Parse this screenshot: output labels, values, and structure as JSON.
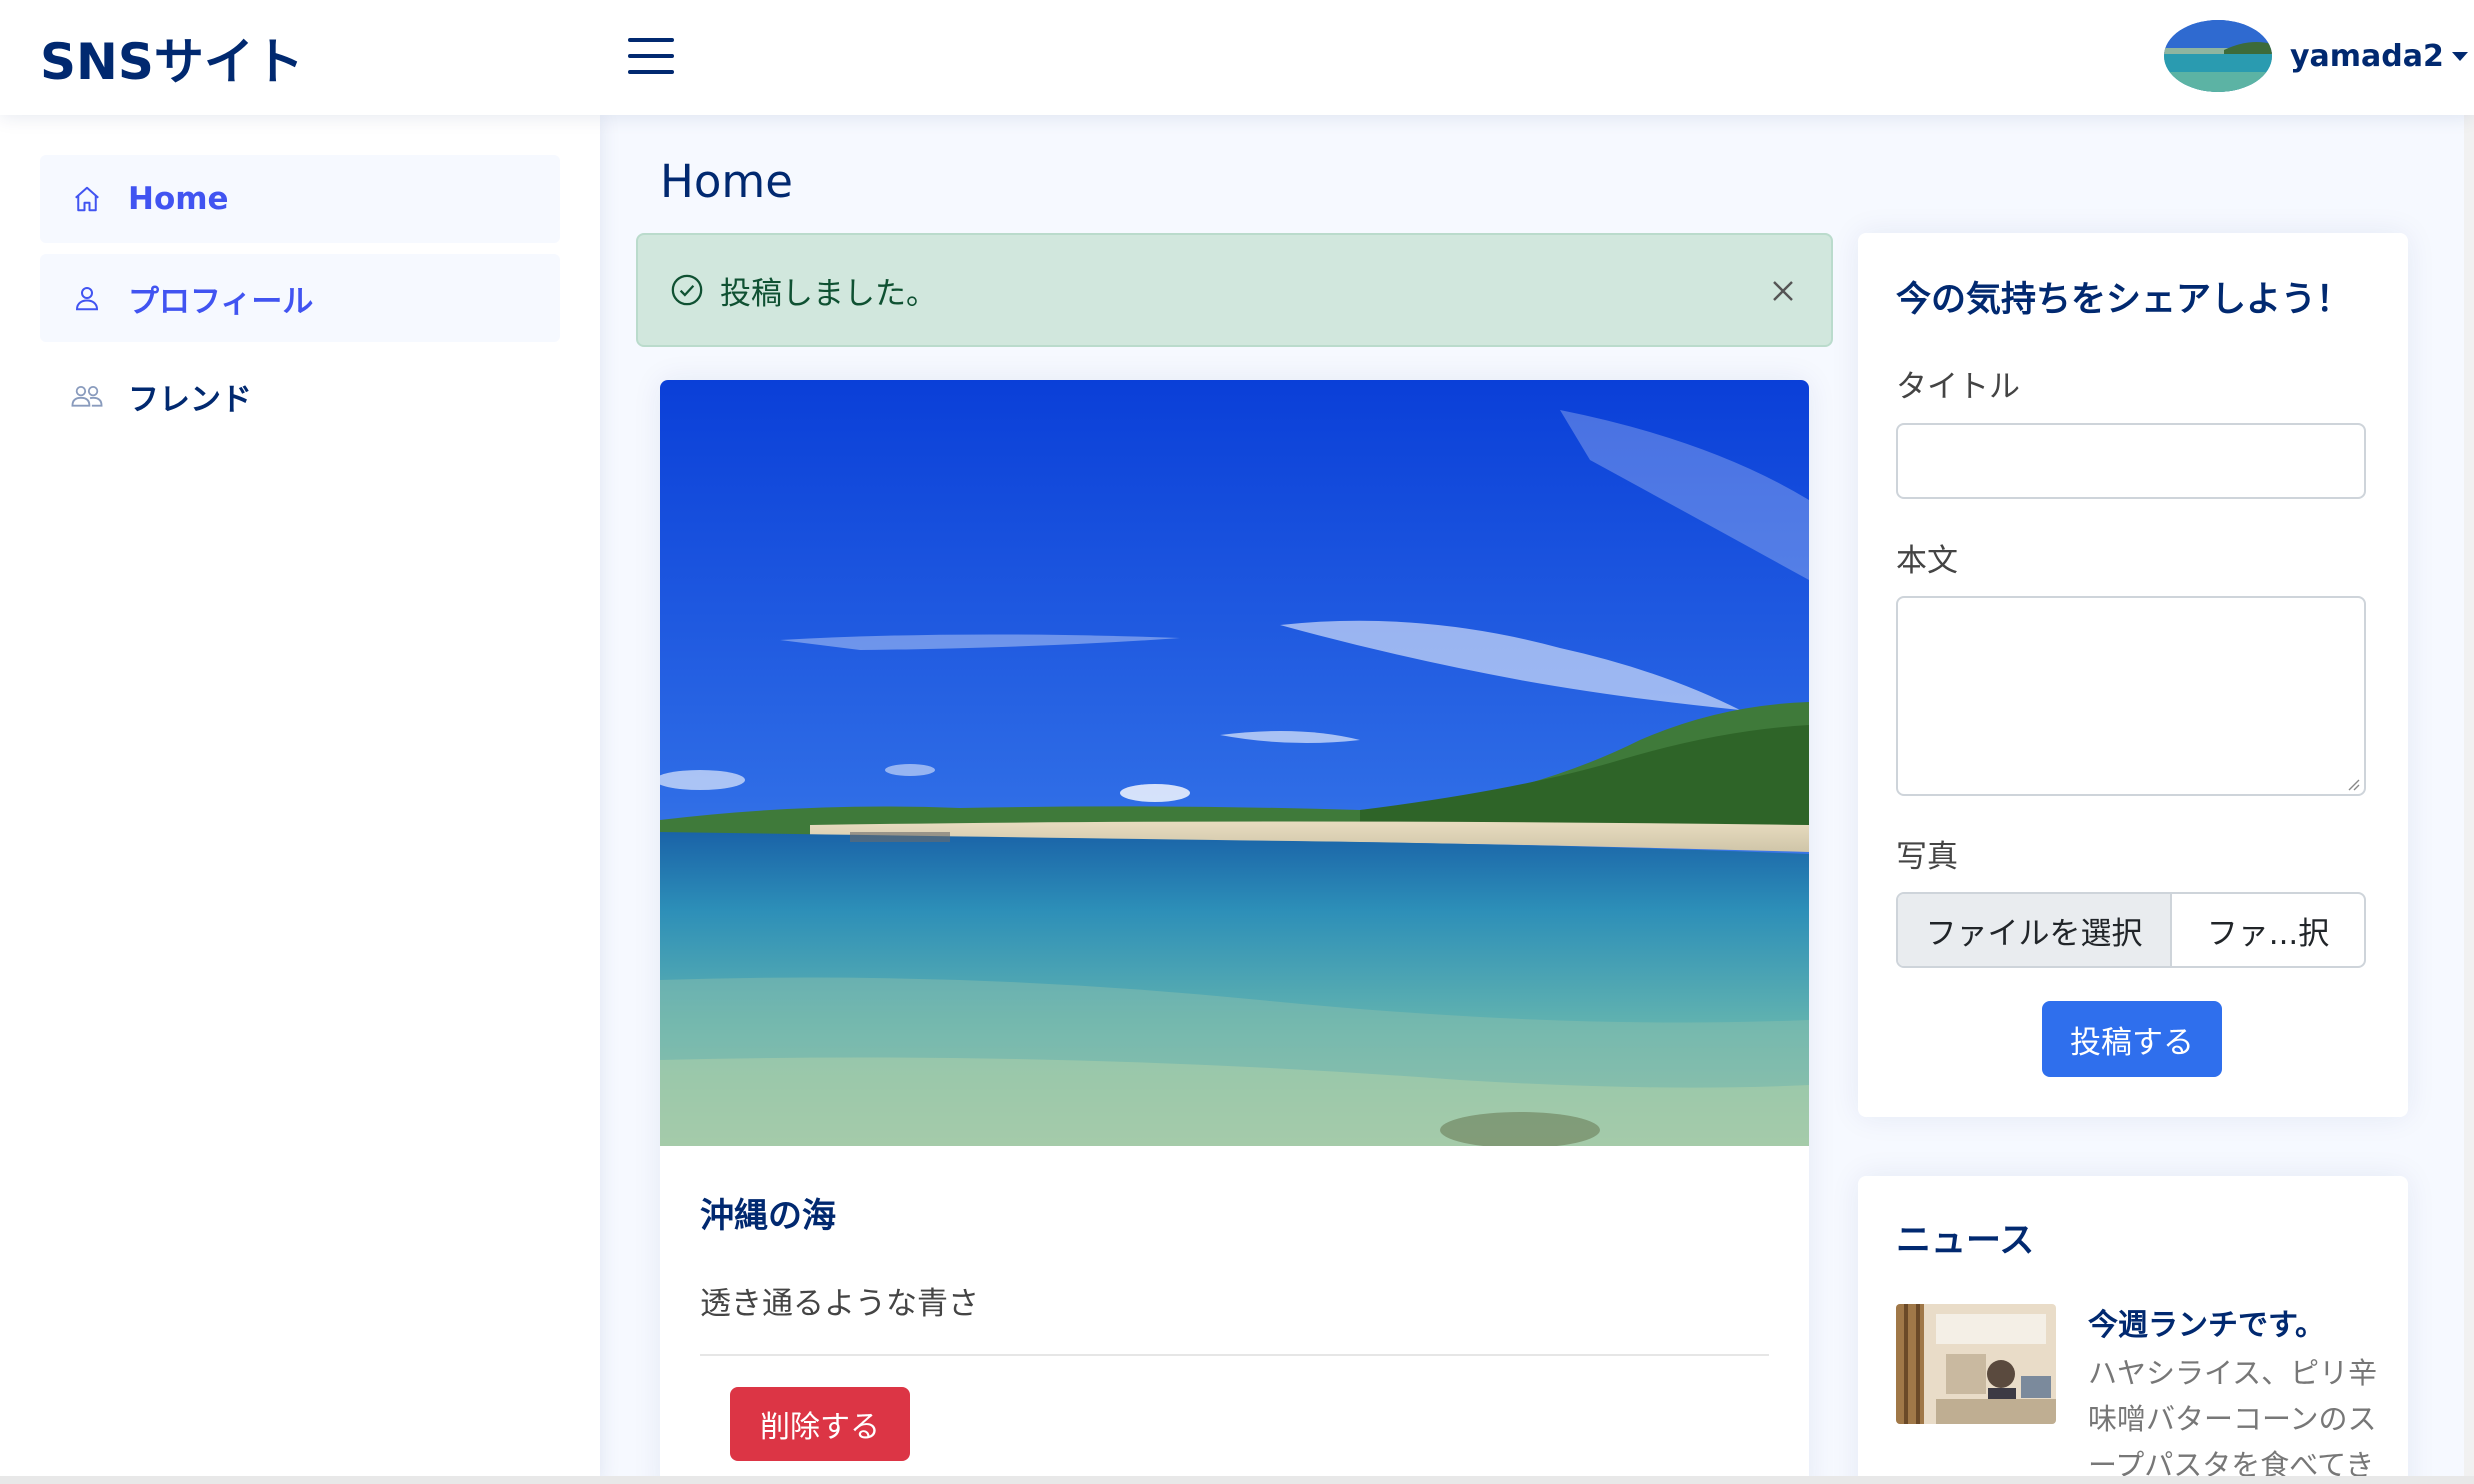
{
  "header": {
    "brand": "SNSサイト",
    "user_name": "yamada2"
  },
  "sidebar": {
    "items": [
      {
        "label": "Home",
        "icon": "house-icon",
        "active": true
      },
      {
        "label": "プロフィール",
        "icon": "person-icon",
        "active": true
      },
      {
        "label": "フレンド",
        "icon": "people-icon",
        "active": false
      }
    ]
  },
  "main": {
    "page_title": "Home",
    "alert": {
      "text": "投稿しました。",
      "color": "#d1e7dd"
    },
    "post": {
      "title": "沖縄の海",
      "body": "透き通るような青さ",
      "delete_label": "削除する"
    }
  },
  "share_form": {
    "heading": "今の気持ちをシェアしよう！",
    "title_label": "タイトル",
    "body_label": "本文",
    "photo_label": "写真",
    "file_button": "ファイルを選択",
    "file_name": "ファ...択",
    "submit_label": "投稿する"
  },
  "news": {
    "heading": "ニュース",
    "items": [
      {
        "title": "今週ランチです。",
        "text": "ハヤシライス、ピリ辛味噌バターコーンのスープパスタを食べてき"
      }
    ]
  },
  "colors": {
    "accent": "#4154f1",
    "navy": "#012970",
    "primary_button": "#2f6fed",
    "danger_button": "#dc3545"
  }
}
